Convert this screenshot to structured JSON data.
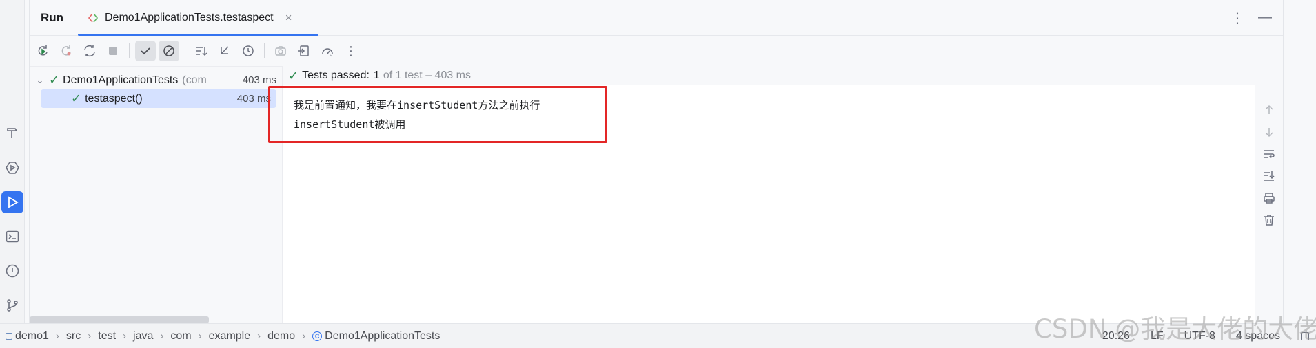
{
  "panel": {
    "title": "Run"
  },
  "tab": {
    "label": "Demo1ApplicationTests.testaspect",
    "close": "×"
  },
  "header_right": {
    "more": "⋮",
    "minimize": "—"
  },
  "toolbar": {
    "buttons": [
      "rerun-icon",
      "rerun-failed-icon",
      "toggle-auto-test-icon",
      "stop-icon",
      "show-passed-icon",
      "show-ignored-icon",
      "sort-alpha-icon",
      "collapse-icon",
      "history-icon",
      "screenshot-icon",
      "export-icon",
      "coverage-icon",
      "more-icon"
    ],
    "more": "⋮"
  },
  "tree": {
    "root": {
      "label": "Demo1ApplicationTests",
      "suffix": "(com",
      "duration": "403 ms"
    },
    "child": {
      "label": "testaspect()",
      "duration": "403 ms"
    }
  },
  "console": {
    "summary_prefix": "Tests passed:",
    "summary_count": "1",
    "summary_rest": "of 1 test – 403 ms",
    "lines": [
      "我是前置通知，我要在insertStudent方法之前执行",
      "insertStudent被调用"
    ]
  },
  "statusbar": {
    "breadcrumbs": [
      "demo1",
      "src",
      "test",
      "java",
      "com",
      "example",
      "demo",
      "Demo1ApplicationTests"
    ],
    "position": "20:26",
    "line_ending": "LF",
    "encoding": "UTF-8",
    "indent": "4 spaces"
  },
  "watermark": "CSDN @我是大佬的大佬",
  "colors": {
    "accent": "#3574f0",
    "pass": "#2d8a4e",
    "highlight_box": "#e32626"
  }
}
